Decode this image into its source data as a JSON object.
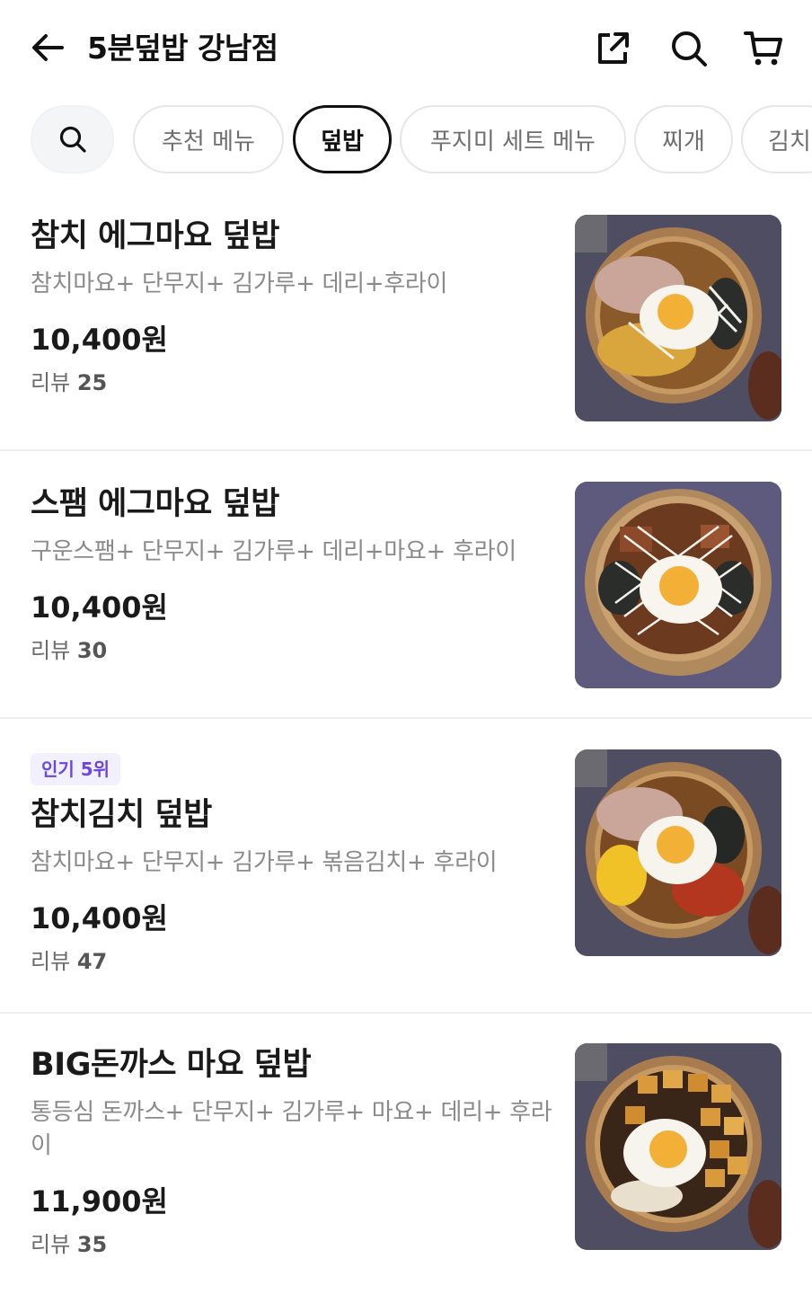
{
  "header": {
    "store_title": "5분덮밥 강남점"
  },
  "categories": [
    {
      "label": "추천 메뉴",
      "active": false
    },
    {
      "label": "덮밥",
      "active": true
    },
    {
      "label": "푸지미 세트 메뉴",
      "active": false
    },
    {
      "label": "찌개",
      "active": false
    },
    {
      "label": "김치",
      "active": false
    }
  ],
  "menu": [
    {
      "name": "참치 에그마요 덮밥",
      "description": "참치마요+ 단무지+ 김가루+ 데리+후라이",
      "price": "10,400원",
      "review_label": "리뷰",
      "review_count": "25",
      "photo": "tuna-egg-mayo-bowl"
    },
    {
      "name": "스팸 에그마요 덮밥",
      "description": "구운스팸+ 단무지+ 김가루+ 데리+마요+ 후라이",
      "price": "10,400원",
      "review_label": "리뷰",
      "review_count": "30",
      "photo": "spam-egg-mayo-bowl"
    },
    {
      "badge": "인기 5위",
      "name": "참치김치 덮밥",
      "description": "참치마요+ 단무지+ 김가루+ 볶음김치+ 후라이",
      "price": "10,400원",
      "review_label": "리뷰",
      "review_count": "47",
      "photo": "tuna-kimchi-bowl"
    },
    {
      "name": "BIG돈까스 마요 덮밥",
      "description": "통등심 돈까스+ 단무지+ 김가루+ 마요+ 데리+ 후라이",
      "price": "11,900원",
      "review_label": "리뷰",
      "review_count": "35",
      "photo": "big-pork-cutlet-mayo-bowl"
    }
  ],
  "colors": {
    "badge_text": "#6b47e0",
    "badge_bg": "#f3f0fe",
    "chip_active_border": "#111111"
  }
}
